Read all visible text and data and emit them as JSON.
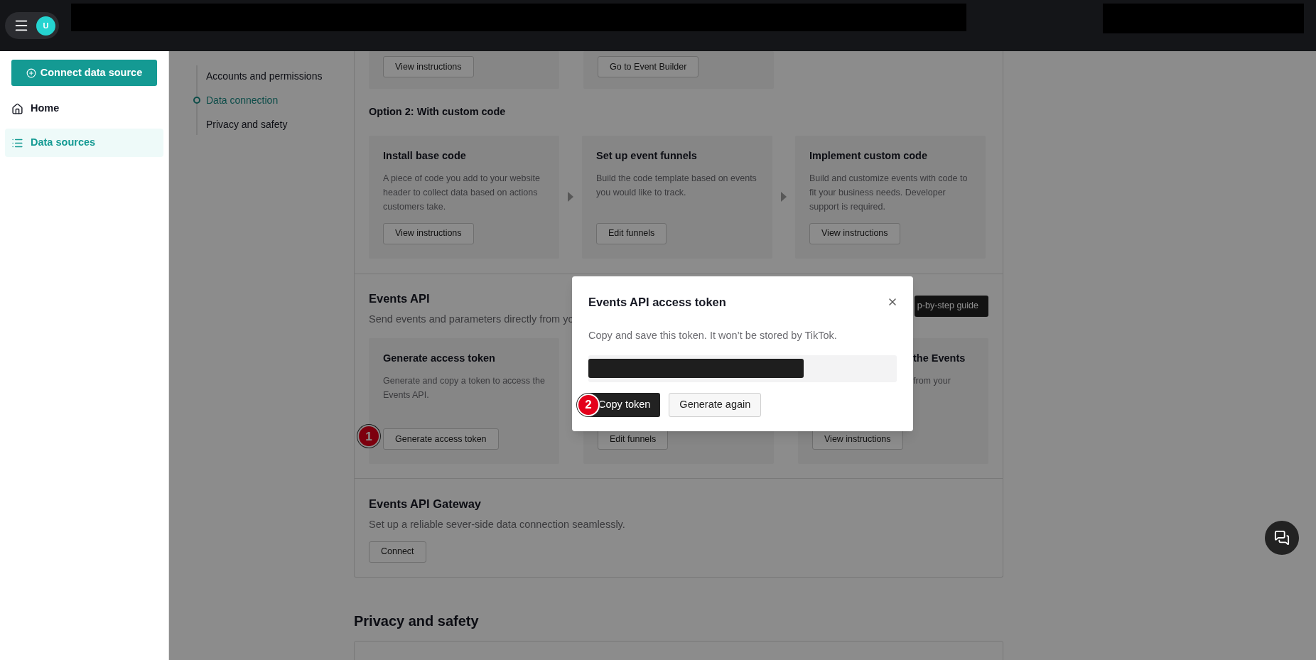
{
  "header": {
    "avatar": "U"
  },
  "sidebar": {
    "connect_button": "Connect data source",
    "items": [
      {
        "label": "Home",
        "kind": "home",
        "selected": false
      },
      {
        "label": "Data sources",
        "kind": "list",
        "selected": true
      }
    ]
  },
  "section_nav": [
    {
      "label": "Accounts and permissions",
      "selected": false
    },
    {
      "label": "Data connection",
      "selected": true
    },
    {
      "label": "Privacy and safety",
      "selected": false
    }
  ],
  "option1_cards": [
    {
      "button": "View instructions"
    },
    {
      "button": "Go to Event Builder"
    }
  ],
  "option2": {
    "heading": "Option 2: With custom code",
    "cards": [
      {
        "title": "Install base code",
        "description": "A piece of code you add to your website header to collect data based on actions customers take.",
        "button": "View instructions"
      },
      {
        "title": "Set up event funnels",
        "description": "Build the code template based on events you would like to track.",
        "button": "Edit funnels"
      },
      {
        "title": "Implement custom code",
        "description": "Build and customize events with code to fit your business needs. Developer support is required.",
        "button": "View instructions"
      }
    ]
  },
  "events_api": {
    "title": "Events API",
    "subtitle": "Send events and parameters directly from yo",
    "guide_button": "p-by-step guide",
    "cards": [
      {
        "title": "Generate access token",
        "description": "Generate and copy a token to access the Events API.",
        "button": "Generate access token",
        "step": "1"
      },
      {
        "button": "Edit funnels"
      },
      {
        "title": "the Events",
        "description": "from your",
        "button": "View instructions"
      }
    ]
  },
  "gateway": {
    "title": "Events API Gateway",
    "subtitle": "Set up a reliable sever-side data connection seamlessly.",
    "button": "Connect"
  },
  "privacy_heading": "Privacy and safety",
  "modal": {
    "title": "Events API access token",
    "message": "Copy and save this token. It won’t be stored by TikTok.",
    "buttons": [
      {
        "label": "Copy token",
        "kind": "primary",
        "step": "2"
      },
      {
        "label": "Generate again",
        "kind": "secondary"
      }
    ]
  }
}
